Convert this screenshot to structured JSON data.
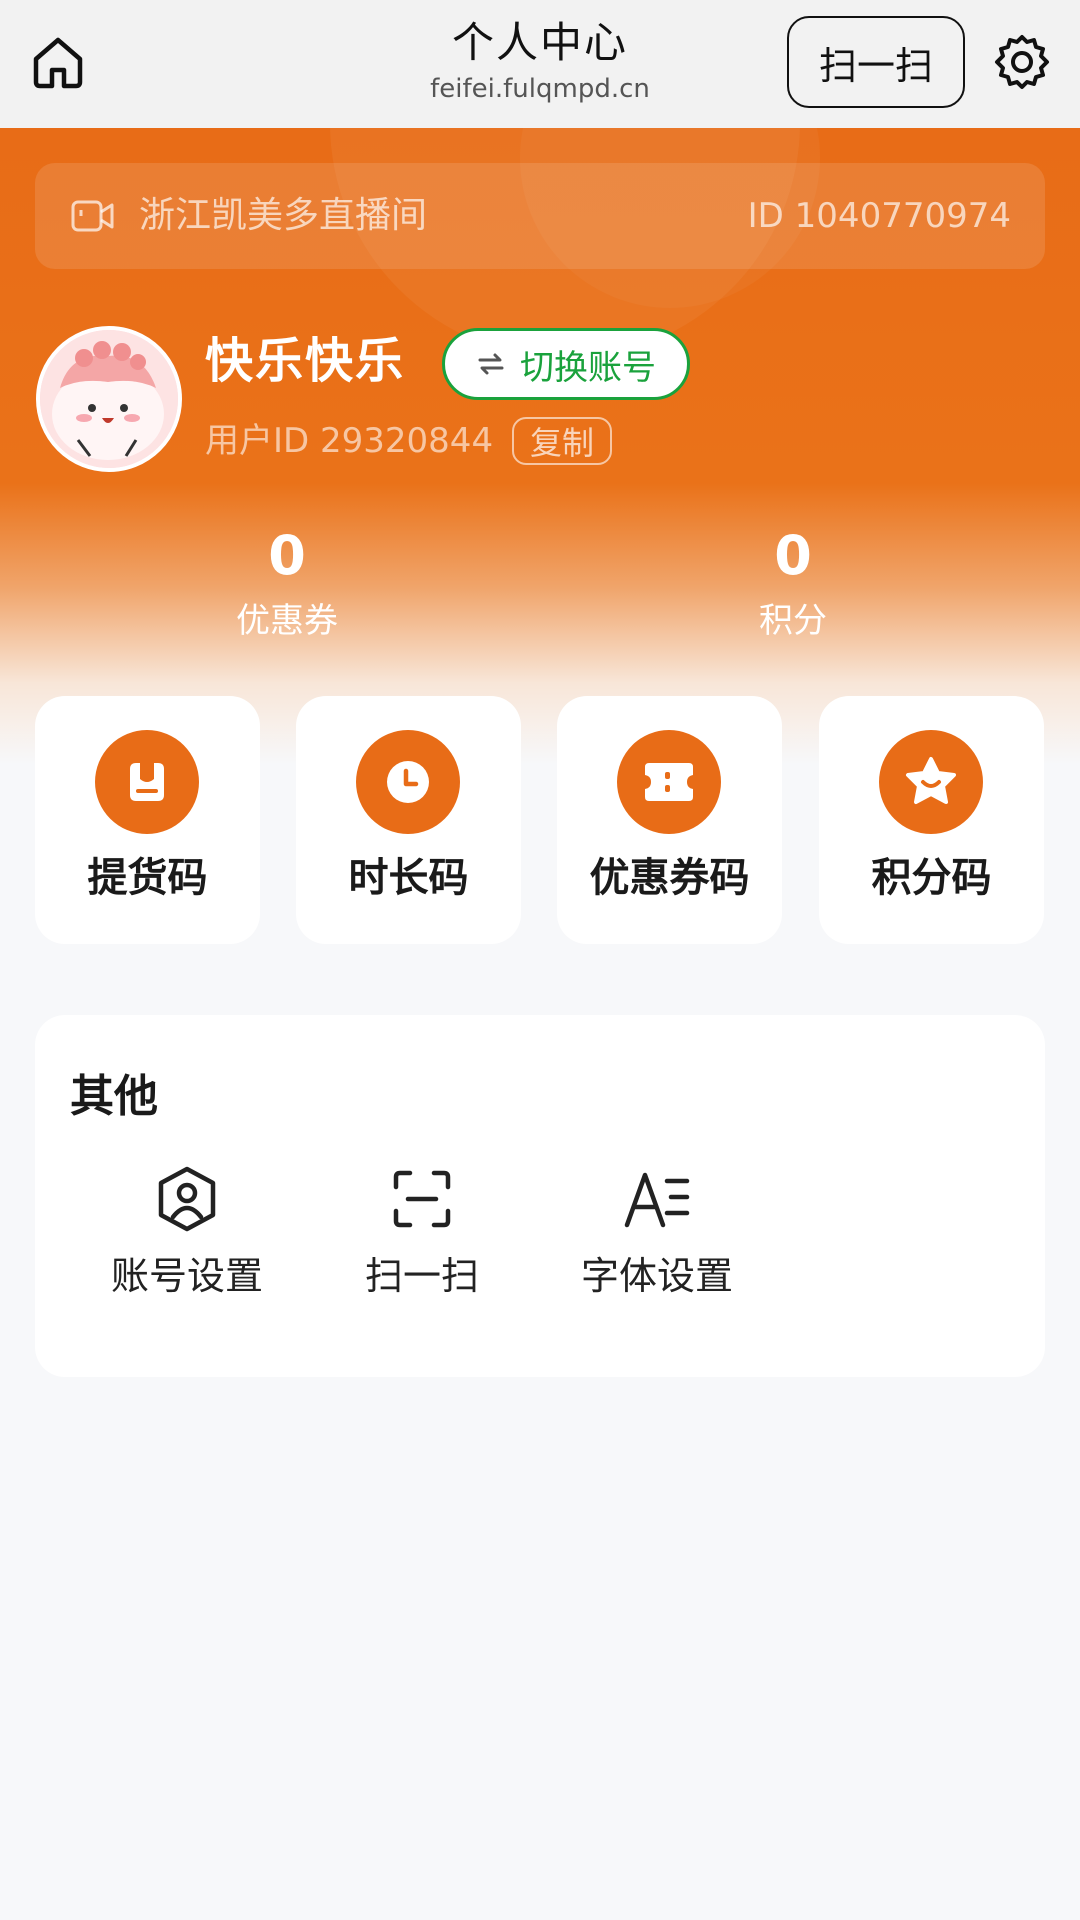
{
  "topbar": {
    "title": "个人中心",
    "domain": "feifei.fulqmpd.cn",
    "scan_label": "扫一扫",
    "icons": {
      "home": "home-icon",
      "settings": "gear-icon"
    }
  },
  "live_room": {
    "name": "浙江凯美多直播间",
    "id_text": "ID 1040770974",
    "icon": "video-camera-icon"
  },
  "user": {
    "name": "快乐快乐",
    "switch_label": "切换账号",
    "id_text": "用户ID 29320844",
    "copy_label": "复制"
  },
  "stats": [
    {
      "value": "0",
      "label": "优惠券"
    },
    {
      "value": "0",
      "label": "积分"
    }
  ],
  "codes": [
    {
      "label": "提货码",
      "icon": "pickup-bag-icon"
    },
    {
      "label": "时长码",
      "icon": "clock-icon"
    },
    {
      "label": "优惠券码",
      "icon": "ticket-icon"
    },
    {
      "label": "积分码",
      "icon": "star-icon"
    }
  ],
  "other": {
    "title": "其他",
    "items": [
      {
        "label": "账号设置",
        "icon": "user-hexagon-icon"
      },
      {
        "label": "扫一扫",
        "icon": "scan-icon"
      },
      {
        "label": "字体设置",
        "icon": "font-size-icon"
      }
    ]
  },
  "colors": {
    "accent": "#e86c17",
    "switch_green": "#1aa23c",
    "background": "#f7f8fa"
  }
}
